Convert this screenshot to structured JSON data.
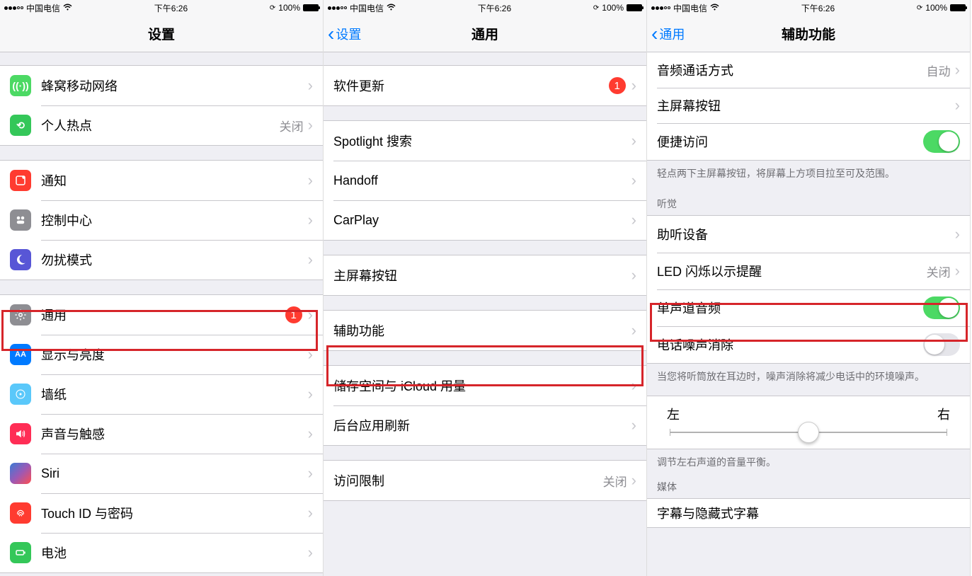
{
  "status": {
    "carrier": "中国电信",
    "time": "下午6:26",
    "battery": "100%"
  },
  "screen1": {
    "title": "设置",
    "rows": {
      "cellular": "蜂窝移动网络",
      "hotspot": "个人热点",
      "hotspot_value": "关闭",
      "notifications": "通知",
      "control_center": "控制中心",
      "dnd": "勿扰模式",
      "general": "通用",
      "general_badge": "1",
      "display": "显示与亮度",
      "wallpaper": "墙纸",
      "sounds": "声音与触感",
      "siri": "Siri",
      "touchid": "Touch ID 与密码",
      "battery": "电池"
    }
  },
  "screen2": {
    "back": "设置",
    "title": "通用",
    "rows": {
      "software_update": "软件更新",
      "software_badge": "1",
      "spotlight": "Spotlight 搜索",
      "handoff": "Handoff",
      "carplay": "CarPlay",
      "home_button": "主屏幕按钮",
      "accessibility": "辅助功能",
      "storage": "储存空间与 iCloud 用量",
      "background_refresh": "后台应用刷新",
      "restrictions": "访问限制",
      "restrictions_value": "关闭"
    }
  },
  "screen3": {
    "back": "通用",
    "title": "辅助功能",
    "rows": {
      "call_audio": "音频通话方式",
      "call_audio_value": "自动",
      "home_button": "主屏幕按钮",
      "reachability": "便捷访问",
      "reachability_footer": "轻点两下主屏幕按钮，将屏幕上方项目拉至可及范围。",
      "hearing_header": "听觉",
      "hearing_devices": "助听设备",
      "led_flash": "LED 闪烁以示提醒",
      "led_flash_value": "关闭",
      "mono_audio": "单声道音频",
      "noise_cancel": "电话噪声消除",
      "noise_footer": "当您将听筒放在耳边时，噪声消除将减少电话中的环境噪声。",
      "balance_left": "左",
      "balance_right": "右",
      "balance_footer": "调节左右声道的音量平衡。",
      "media_header": "媒体",
      "subtitles": "字幕与隐藏式字幕"
    }
  }
}
